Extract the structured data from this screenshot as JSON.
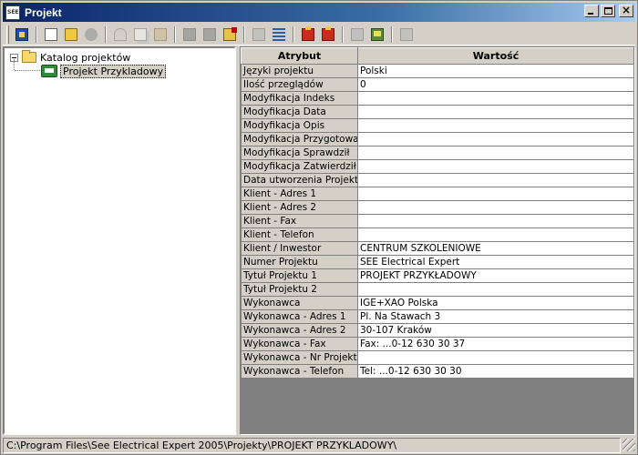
{
  "window": {
    "title": "Projekt"
  },
  "toolbar": {
    "buttons": [
      {
        "name": "exit-button",
        "icon": "exit-icon"
      },
      {
        "name": "new-button",
        "icon": "document-icon"
      },
      {
        "name": "open-button",
        "icon": "open-folder-icon"
      },
      {
        "name": "settings-button",
        "icon": "gear-icon"
      },
      {
        "name": "cut-button",
        "icon": "scissors-icon"
      },
      {
        "name": "copy-button",
        "icon": "copy-icon"
      },
      {
        "name": "paste-button",
        "icon": "paste-icon"
      },
      {
        "name": "component-button",
        "icon": "cube-icon"
      },
      {
        "name": "folder-button",
        "icon": "folder-icon"
      },
      {
        "name": "delete-folder-button",
        "icon": "delete-folder-icon"
      },
      {
        "name": "import-button",
        "icon": "import-icon"
      },
      {
        "name": "list-button",
        "icon": "list-icon"
      },
      {
        "name": "red-tool-1-button",
        "icon": "toolbox-icon"
      },
      {
        "name": "red-tool-2-button",
        "icon": "toolbox-icon"
      },
      {
        "name": "export-button",
        "icon": "export-icon"
      },
      {
        "name": "monitor-button",
        "icon": "monitor-icon"
      },
      {
        "name": "export-2-button",
        "icon": "export-icon"
      }
    ]
  },
  "tree": {
    "root": {
      "label": "Katalog projektów",
      "icon": "folder-icon",
      "expanded": true
    },
    "child": {
      "label": "Projekt Przykladowy",
      "icon": "see-project-icon",
      "selected": true
    }
  },
  "grid": {
    "headers": [
      "Atrybut",
      "Wartość"
    ],
    "rows": [
      [
        "Języki projektu",
        "Polski"
      ],
      [
        "Ilość przeglądów",
        "0"
      ],
      [
        "Modyfikacja Indeks",
        ""
      ],
      [
        "Modyfikacja Data",
        ""
      ],
      [
        "Modyfikacja Opis",
        ""
      ],
      [
        "Modyfikacja Przygotował",
        ""
      ],
      [
        "Modyfikacja Sprawdził",
        ""
      ],
      [
        "Modyfikacja Zatwierdził",
        ""
      ],
      [
        "Data utworzenia Projektu",
        ""
      ],
      [
        "Klient - Adres 1",
        ""
      ],
      [
        "Klient - Adres 2",
        ""
      ],
      [
        "Klient - Fax",
        ""
      ],
      [
        "Klient - Telefon",
        ""
      ],
      [
        "Klient / Inwestor",
        "CENTRUM SZKOLENIOWE"
      ],
      [
        "Numer Projektu",
        "SEE Electrical Expert"
      ],
      [
        "Tytuł Projektu 1",
        "PROJEKT PRZYKŁADOWY"
      ],
      [
        "Tytuł Projektu 2",
        ""
      ],
      [
        "Wykonawca",
        "IGE+XAO Polska"
      ],
      [
        "Wykonawca - Adres 1",
        "Pl. Na Stawach 3"
      ],
      [
        "Wykonawca - Adres 2",
        "30-107 Kraków"
      ],
      [
        "Wykonawca - Fax",
        "Fax: ...0-12 630 30 37"
      ],
      [
        "Wykonawca - Nr Projektu",
        ""
      ],
      [
        "Wykonawca - Telefon",
        "Tel: ...0-12 630 30 30"
      ]
    ]
  },
  "statusbar": {
    "path": "C:\\Program Files\\See Electrical Expert 2005\\Projekty\\PROJEKT PRZYKLADOWY\\"
  }
}
